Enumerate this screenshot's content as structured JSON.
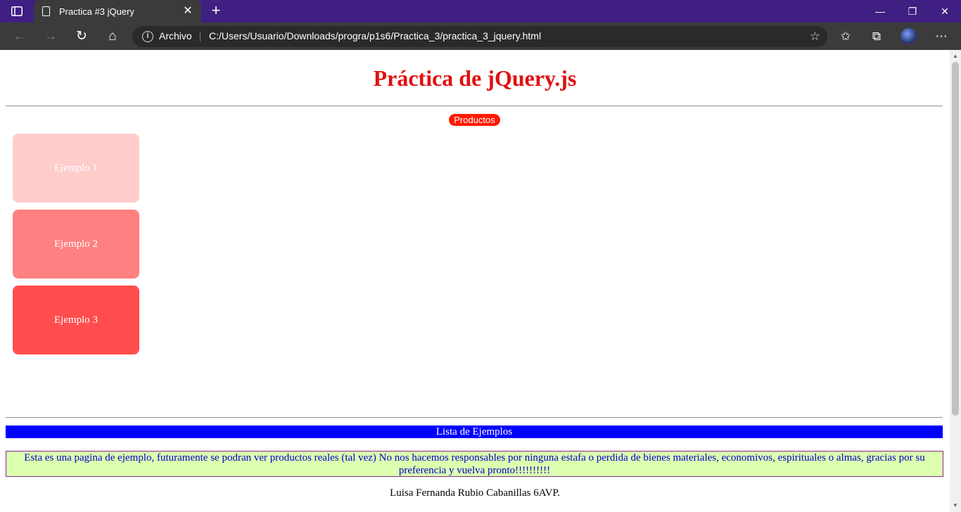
{
  "browser": {
    "tab_title": "Practica #3 jQuery",
    "address_prefix": "Archivo",
    "url": "C:/Users/Usuario/Downloads/progra/p1s6/Practica_3/practica_3_jquery.html"
  },
  "page": {
    "title": "Práctica de jQuery.js",
    "products_badge": "Productos",
    "cards": [
      {
        "label": "Ejemplo 1",
        "color": "#ffcccc"
      },
      {
        "label": "Ejemplo 2",
        "color": "#ff8080"
      },
      {
        "label": "Ejemplo 3",
        "color": "#ff4d4d"
      }
    ],
    "list_bar": "Lista de Ejemplos",
    "notice": "Esta es una pagina de ejemplo, futuramente se podran ver productos reales (tal vez) No nos hacemos responsables por ninguna estafa o perdida de bienes materiales, economivos, espirituales o almas, gracias por su preferencia y vuelva pronto!!!!!!!!!!",
    "footer": "Luisa Fernanda Rubio Cabanillas 6AVP."
  },
  "colors": {
    "tabbar": "#3f1f82",
    "title_red": "#e01010",
    "badge_red": "#ff1a00",
    "list_bar_blue": "#0000ff",
    "notice_bg": "#dcffb0"
  }
}
